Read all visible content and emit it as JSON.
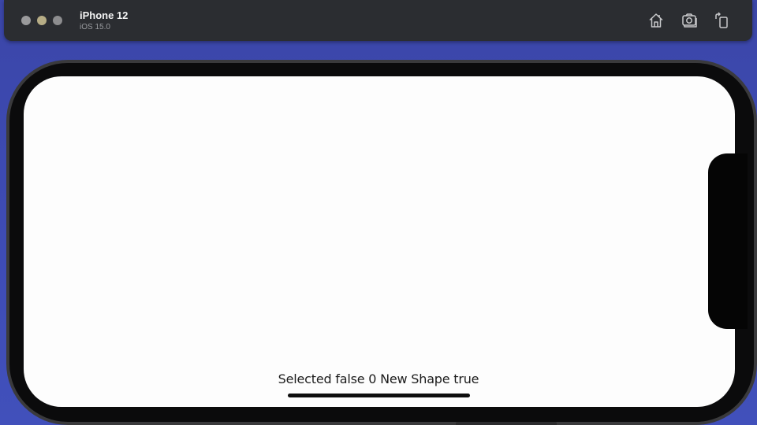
{
  "titlebar": {
    "device_name": "iPhone 12",
    "os_version": "iOS 15.0",
    "icons": [
      "home-icon",
      "screenshot-icon",
      "rotate-icon"
    ]
  },
  "screen": {
    "status_text": "Selected false 0  New Shape true"
  },
  "colors": {
    "desktop_background": "#3d4ab2",
    "titlebar": "#2b2d31",
    "screen": "#fdfdfd",
    "bezel": "#0b0b0c"
  }
}
